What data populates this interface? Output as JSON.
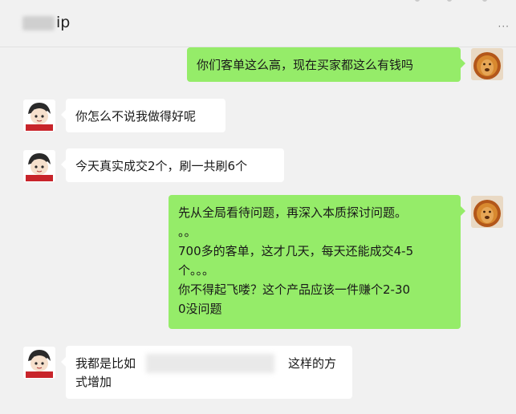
{
  "header": {
    "title": "ip"
  },
  "avatars": {
    "self": "lion-avatar",
    "other": "cartoon-avatar",
    "other_badge": "中国加油"
  },
  "messages": [
    {
      "side": "out",
      "text": "你们客单这么高，现在买家都这么有钱吗"
    },
    {
      "side": "in",
      "text": "你怎么不说我做得好呢"
    },
    {
      "side": "in",
      "text": "今天真实成交2个，刷一共刷6个"
    },
    {
      "side": "out",
      "lines": [
        "先从全局看待问题，再深入本质探讨问题。",
        "。。",
        "700多的客单，这才几天，每天还能成交4-5",
        "个。。。",
        "你不得起飞喽？这个产品应该一件赚个2-30",
        "0没问题"
      ]
    },
    {
      "side": "in",
      "lines": [
        "我都是比如",
        "这样的方",
        "式增加"
      ]
    }
  ],
  "colors": {
    "background": "#f1f1f1",
    "outgoing_bubble": "#95ec69",
    "incoming_bubble": "#ffffff"
  }
}
